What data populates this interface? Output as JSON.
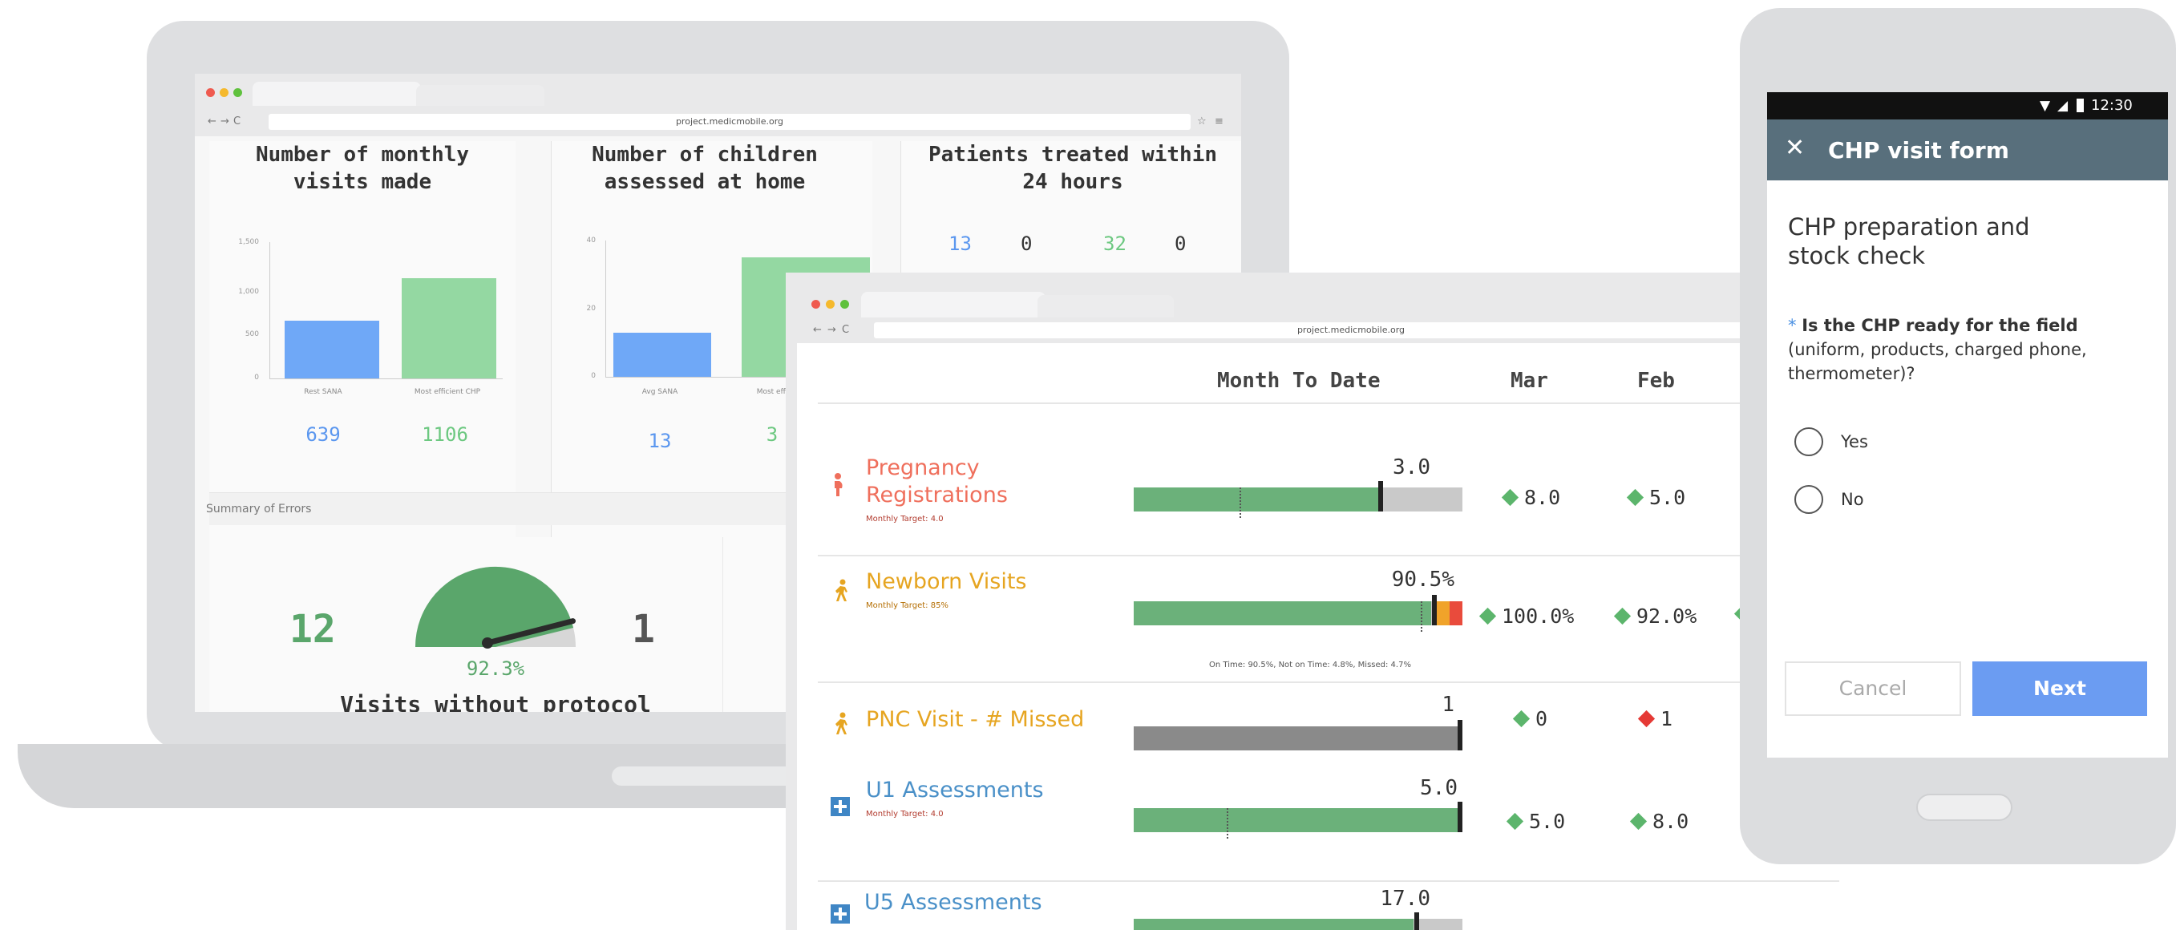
{
  "laptop_window": {
    "url": "project.medicmobile.org",
    "nav": {
      "back": "←",
      "forward": "→",
      "reload": "C"
    },
    "panels": {
      "monthly_visits": {
        "title": "Number of monthly visits made",
        "y_ticks": [
          "1,500",
          "1,000",
          "500",
          "0"
        ],
        "bars": [
          {
            "label": "Rest SANA",
            "value": 639,
            "color": "#6fa8f7"
          },
          {
            "label": "Most efficient CHP",
            "value": 1106,
            "color": "#94d8a2"
          }
        ],
        "numbers": [
          "639",
          "1106"
        ]
      },
      "children_assessed": {
        "title": "Number of children assessed at home",
        "y_ticks": [
          "40",
          "20",
          "0"
        ],
        "bars": [
          {
            "label": "Avg SANA",
            "value": 13,
            "color": "#6fa8f7"
          },
          {
            "label": "Most effi",
            "value": 35,
            "color": "#94d8a2"
          }
        ],
        "numbers": [
          "13",
          "3"
        ]
      },
      "treated_24h": {
        "title": "Patients treated within 24 hours",
        "numbers": [
          "13",
          "0",
          "32",
          "0"
        ]
      }
    },
    "summary_label": "Summary of Errors",
    "gauge": {
      "left_number": "12",
      "right_number": "1",
      "percent": "92.3%",
      "value_fraction": 0.923,
      "caption": "Visits without protocol"
    }
  },
  "dashboard_window": {
    "url": "project.medicmobile.org",
    "nav": {
      "back": "←",
      "forward": "→",
      "reload": "C"
    },
    "columns": {
      "mtd": "Month To Date",
      "m1": "Mar",
      "m2": "Feb"
    },
    "rows": [
      {
        "key": "pregnancy",
        "title_line1": "Pregnancy",
        "title_line2": "Registrations",
        "target": "Monthly Target: 4.0",
        "value": "3.0",
        "fill": 0.75,
        "mar": "8.0",
        "feb": "5.0",
        "mar_status": "good",
        "feb_status": "good",
        "color": "#ef6f5c",
        "icon": "pregnant-woman-icon"
      },
      {
        "key": "newborn",
        "title_line1": "Newborn Visits",
        "target": "Monthly Target: 85%",
        "value": "90.5%",
        "fill": 0.905,
        "mar": "100.0%",
        "feb": "92.0%",
        "mar_status": "good",
        "feb_status": "good",
        "breakdown": "On Time: 90.5%, Not on Time: 4.8%, Missed: 4.7%",
        "color": "#e6a521",
        "icon": "walking-person-icon"
      },
      {
        "key": "pnc",
        "title_line1": "PNC Visit - # Missed",
        "value": "1",
        "fill": 1.0,
        "mar": "0",
        "feb": "1",
        "mar_status": "good",
        "feb_status": "bad",
        "color": "#e6a521",
        "icon": "walking-person-icon"
      },
      {
        "key": "u1",
        "title_line1": "U1 Assessments",
        "target": "Monthly Target: 4.0",
        "value": "5.0",
        "fill": 1.0,
        "mar": "5.0",
        "feb": "8.0",
        "mar_status": "good",
        "feb_status": "good",
        "color": "#4a90c8",
        "icon": "medical-cross-icon"
      },
      {
        "key": "u5",
        "title_line1": "U5 Assessments",
        "value": "17.0",
        "fill": 0.85,
        "color": "#4a90c8",
        "icon": "medical-cross-icon"
      }
    ],
    "status_colors": {
      "good": "#5cb56c",
      "bad": "#e53935"
    }
  },
  "phone": {
    "status_time": "12:30",
    "appbar_title": "CHP visit form",
    "section_title": "CHP preparation and stock check",
    "required_marker": "*",
    "question_bold": "Is the CHP ready for the field",
    "question_rest": "(uniform, products, charged phone, thermometer)?",
    "options": [
      "Yes",
      "No"
    ],
    "cancel_label": "Cancel",
    "next_label": "Next",
    "next_color": "#6b9cf2"
  }
}
